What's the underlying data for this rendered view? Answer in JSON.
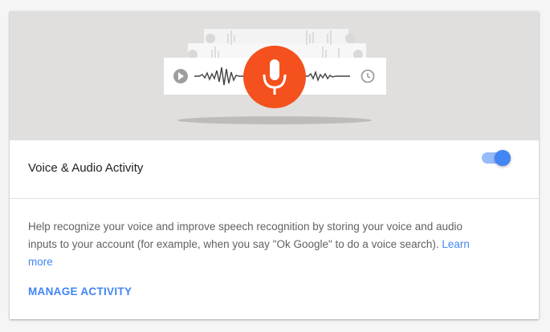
{
  "card": {
    "title": "Voice & Audio Activity",
    "toggle_on": true,
    "description_text": "Help recognize your voice and improve speech recognition by storing your voice and audio inputs to your account (for example, when you say \"Ok Google\" to do a voice search).",
    "learn_more_label": "Learn more",
    "manage_label": "MANAGE ACTIVITY"
  },
  "colors": {
    "accent": "#4285f4",
    "mic": "#f4511e",
    "hero_bg": "#e0dfde"
  },
  "icons": {
    "hero_mic": "microphone-icon",
    "play": "play-icon",
    "clock": "clock-icon"
  }
}
